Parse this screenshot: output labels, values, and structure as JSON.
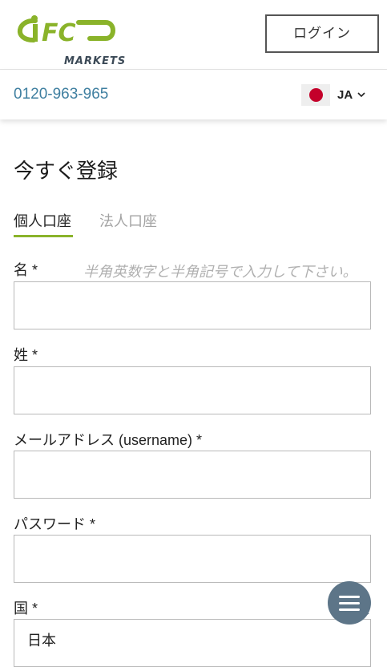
{
  "header": {
    "logo_text": "MARKETS",
    "login_label": "ログイン",
    "phone": "0120-963-965",
    "language": "JA"
  },
  "page": {
    "title": "今すぐ登録"
  },
  "tabs": [
    {
      "label": "個人口座",
      "active": true
    },
    {
      "label": "法人口座",
      "active": false
    }
  ],
  "form": {
    "hint": "半角英数字と半角記号で入力して下さい。",
    "fields": [
      {
        "label": "名 *",
        "value": ""
      },
      {
        "label": "姓 *",
        "value": ""
      },
      {
        "label": "メールアドレス (username) *",
        "value": ""
      },
      {
        "label": "パスワード *",
        "value": ""
      },
      {
        "label": "国 *",
        "value": "日本"
      }
    ]
  },
  "colors": {
    "accent_green": "#8ab32a",
    "phone_blue": "#3f7fa0",
    "fab_bg": "#5d7588"
  },
  "icons": [
    "ifc-logo",
    "japan-flag-icon",
    "chevron-down-icon",
    "chat-menu-icon"
  ]
}
